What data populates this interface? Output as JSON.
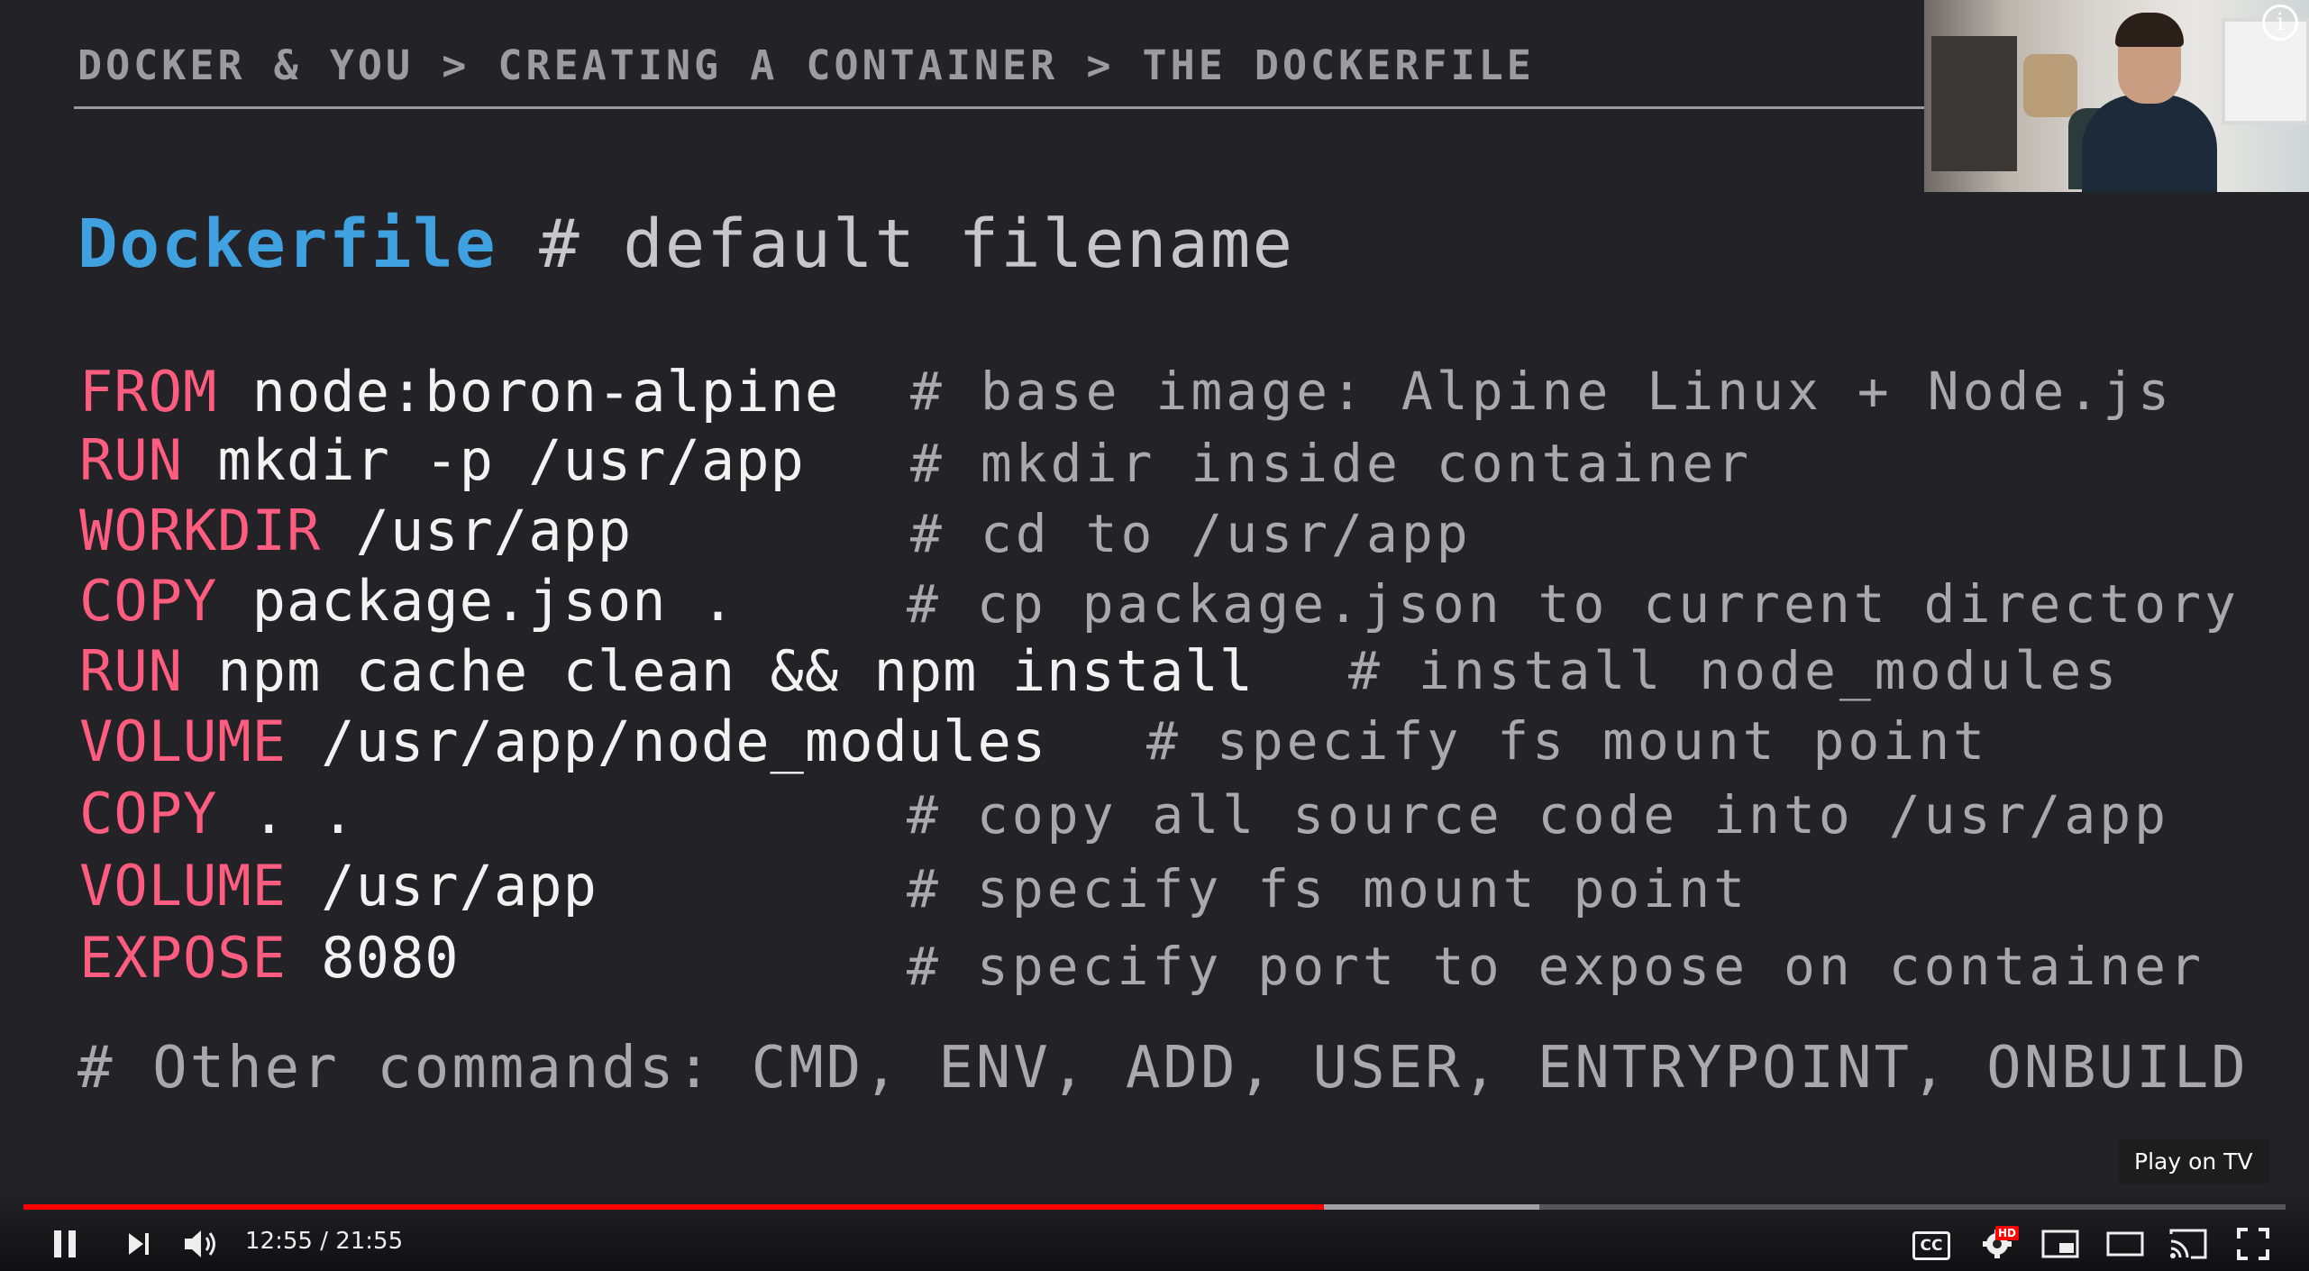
{
  "slide": {
    "breadcrumb": "DOCKER & YOU > CREATING A CONTAINER > THE DOCKERFILE",
    "title_file": "Dockerfile",
    "title_comment": "# default filename",
    "lines": [
      {
        "keyword": "FROM",
        "arg": "node:boron-alpine",
        "comment": "# base image: Alpine Linux + Node.js"
      },
      {
        "keyword": "RUN",
        "arg": "mkdir -p /usr/app",
        "comment": "# mkdir inside container"
      },
      {
        "keyword": "WORKDIR",
        "arg": "/usr/app",
        "comment": "# cd to /usr/app"
      },
      {
        "keyword": "COPY",
        "arg": "package.json .",
        "comment": "# cp package.json to current directory"
      },
      {
        "keyword": "RUN",
        "arg": "npm cache clean && npm install",
        "comment": "# install node_modules"
      },
      {
        "keyword": "VOLUME",
        "arg": "/usr/app/node_modules",
        "comment": "# specify fs mount point"
      },
      {
        "keyword": "COPY",
        "arg": ". .",
        "comment": "# copy all source code into /usr/app"
      },
      {
        "keyword": "VOLUME",
        "arg": "/usr/app",
        "comment": "# specify fs mount point"
      },
      {
        "keyword": "EXPOSE",
        "arg": "8080",
        "comment": "# specify port to expose on container"
      }
    ],
    "other_commands": "# Other commands: CMD, ENV, ADD, USER, ENTRYPOINT, ONBUILD"
  },
  "player": {
    "time_display": "12:55 / 21:55",
    "played_fraction": 0.575,
    "buffered_fraction": 0.67,
    "play_on_tv": "Play on TV",
    "cc_label": "CC",
    "hd_badge": "HD",
    "info_glyph": "i",
    "colors": {
      "progress": "#ff0000",
      "keyword": "#ff5d7f",
      "title": "#3fa1e0"
    }
  },
  "icons": [
    "pause-icon",
    "next-icon",
    "volume-icon",
    "captions-icon",
    "settings-icon",
    "miniplayer-icon",
    "theater-icon",
    "cast-icon",
    "fullscreen-icon",
    "info-icon"
  ]
}
